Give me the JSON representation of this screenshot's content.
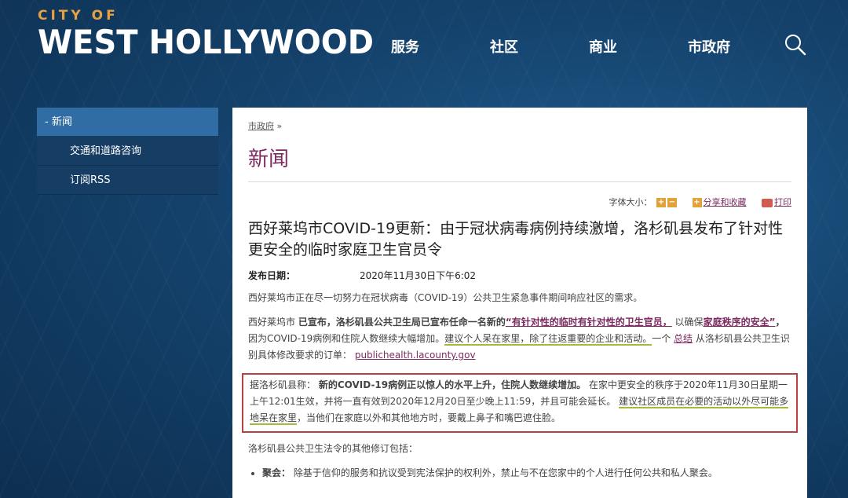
{
  "header": {
    "logo_small": "CITY OF",
    "logo_big": "WEST HOLLYWOOD",
    "nav": [
      "服务",
      "社区",
      "商业",
      "市政府"
    ]
  },
  "sidebar": {
    "active": "- 新闻",
    "items": [
      "交通和道路咨询",
      "订阅RSS"
    ]
  },
  "main": {
    "breadcrumb": "市政府",
    "breadcrumb_sep": " »",
    "title": "新闻",
    "tools": {
      "font_size_label": "字体大小：",
      "plus": "+",
      "minus": "−",
      "share_icon": "+",
      "share": "分享和收藏",
      "print": "打印"
    },
    "article_title": "西好莱坞市COVID-19更新：由于冠状病毒病例持续激增，洛杉矶县发布了针对性更安全的临时家庭卫生官员令",
    "pubdate_label": "发布日期：",
    "pubdate_value": "2020年11月30日下午6:02",
    "p1": "西好莱坞市正在尽一切努力在冠状病毒（COVID-19）公共卫生紧急事件期间响应社区的需求。",
    "p2": {
      "a": "西好莱坞市 ",
      "b": "已宣布，洛杉矶县公共卫生局已宣布任命一名新的",
      "c": "“有针对性的临时有针对性的卫生官员，",
      "d": " 以确保",
      "e": "家庭秩序的安全”",
      "f": "，",
      "g": "因为COVID-19病例和住院人数继续大幅增加。",
      "h": "建议个人呆在家里，除了往返重要的企业和活动。",
      "i": "一个 ",
      "j": "总结",
      "k": " 从洛杉矶县公共卫生识别具体修改要求的订单：  ",
      "l": "publichealth.lacounty.gov"
    },
    "p3": {
      "a": "据洛杉矶县称： ",
      "b": "新的COVID-19病例正以惊人的水平上升，住院人数继续增加。",
      "c": " 在家中更安全的秩序于2020年11月30日星期一上午12:01生效，并将一直有效到2020年12月20日至少晚上11:59，并且可能会延长。 ",
      "d": "建议社区成员在必要的活动以外尽可能多地呆在家里",
      "e": "，当他们在家庭以外和其他地方时，要戴上鼻子和嘴巴遮住脸。"
    },
    "p4": "洛杉矶县公共卫生法令的其他修订包括：",
    "bullet1_label": "聚会：",
    "bullet1_text": " 除基于信仰的服务和抗议受到宪法保护的权利外，禁止与不在您家中的个人进行任何公共和私人聚会。"
  }
}
